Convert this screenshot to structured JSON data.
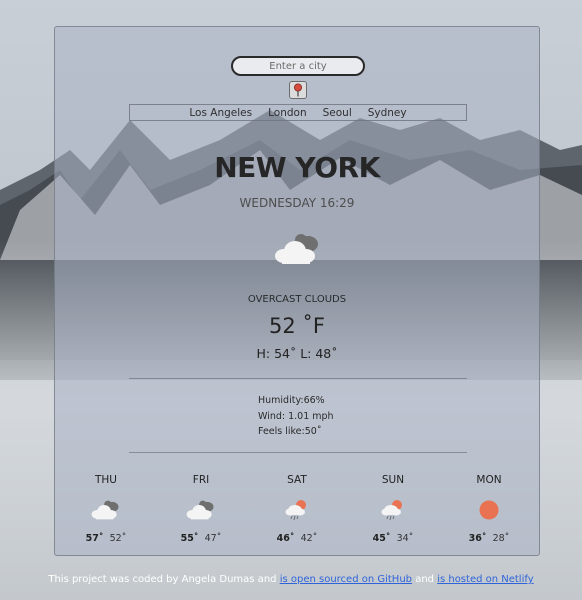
{
  "search": {
    "placeholder": "Enter a city"
  },
  "location_button": {
    "icon": "map-pin-icon"
  },
  "quick_cities": [
    "Los  Angeles",
    "London",
    "Seoul",
    "Sydney"
  ],
  "current": {
    "city": "NEW YORK",
    "day_time": "WEDNESDAY 16:29",
    "icon": "cloud-icon",
    "condition": "OVERCAST CLOUDS",
    "temperature": "52 ˚F",
    "high_low": "H: 54˚ L: 48˚",
    "humidity": "Humidity:66%",
    "wind": "Wind: 1.01 mph",
    "feels_like": "Feels like:50˚"
  },
  "forecast": [
    {
      "day": "THU",
      "icon": "cloud-icon",
      "high": "57˚",
      "low": "52˚"
    },
    {
      "day": "FRI",
      "icon": "cloud-icon",
      "high": "55˚",
      "low": "47˚"
    },
    {
      "day": "SAT",
      "icon": "rain-icon",
      "high": "46˚",
      "low": "42˚"
    },
    {
      "day": "SUN",
      "icon": "rain-icon",
      "high": "45˚",
      "low": "34˚"
    },
    {
      "day": "MON",
      "icon": "sun-icon",
      "high": "36˚",
      "low": "28˚"
    }
  ],
  "footer": {
    "text_prefix": "This project was coded by Angela Dumas and ",
    "github_link": "is open sourced on GitHub",
    "text_middle": " and ",
    "netlify_link": "is hosted on Netlify"
  },
  "colors": {
    "sun": "#e87252",
    "cloud_light": "#f4f4f4",
    "cloud_dark": "#6f6f6f"
  }
}
